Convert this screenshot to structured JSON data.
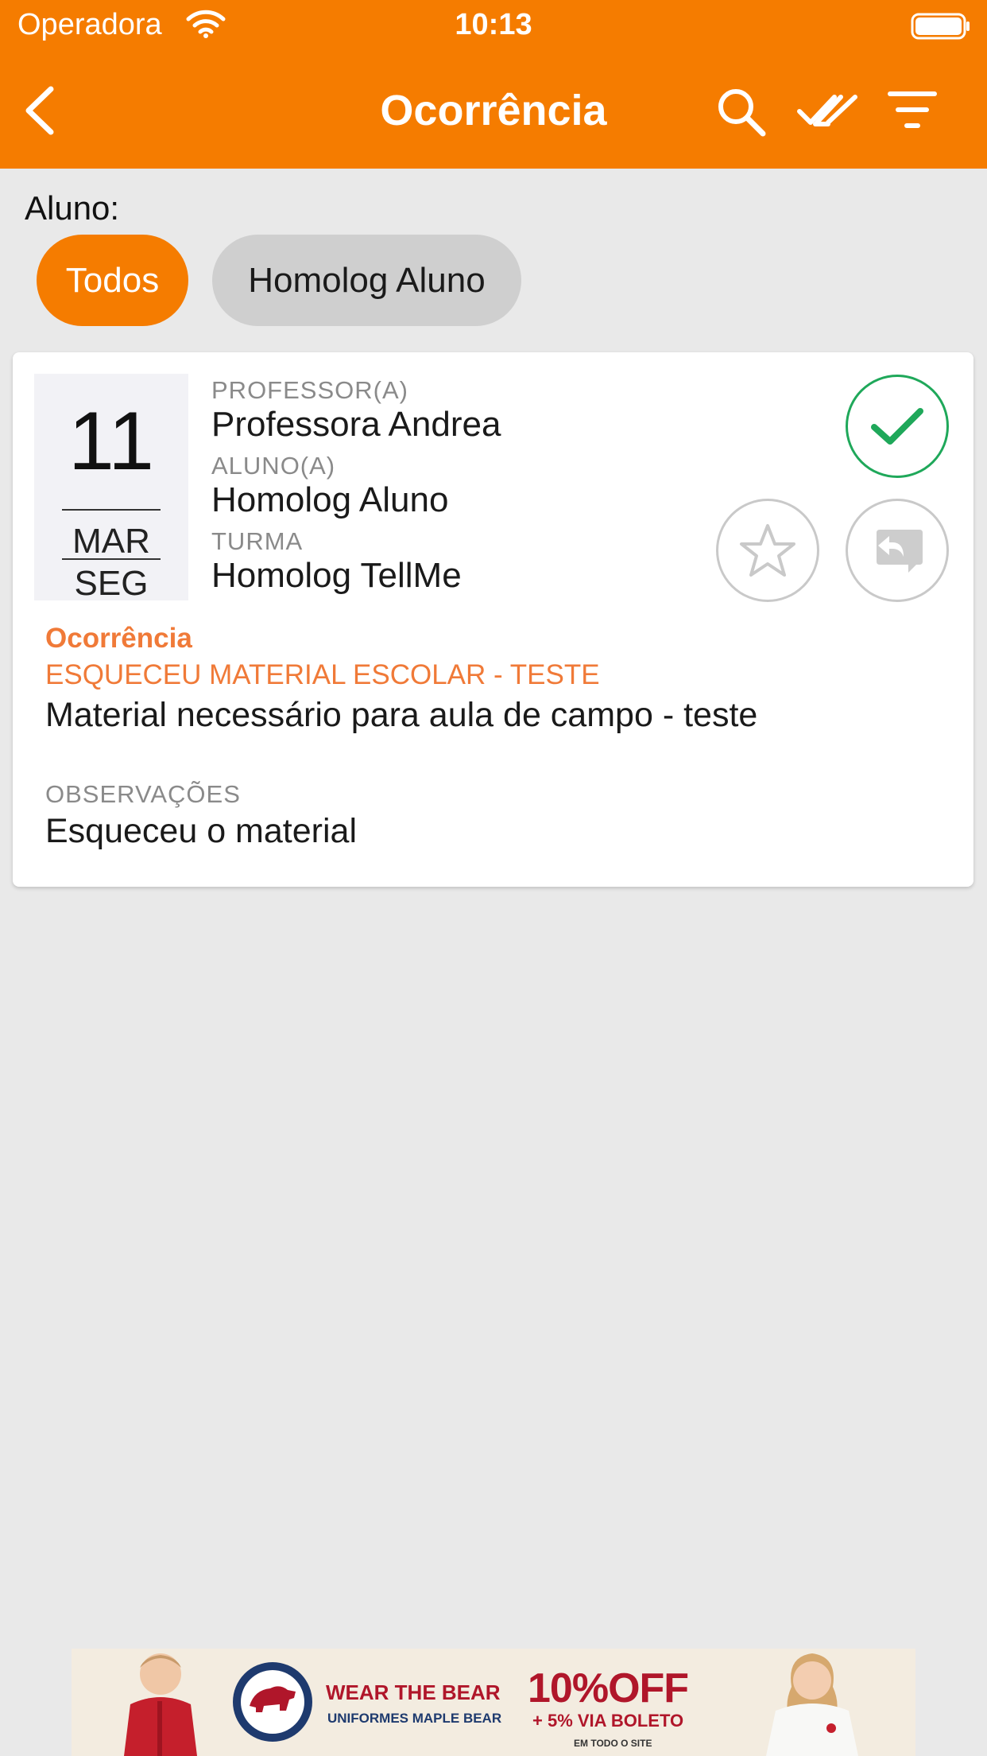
{
  "status_bar": {
    "carrier": "Operadora",
    "time": "10:13"
  },
  "nav": {
    "title": "Ocorrência"
  },
  "filter": {
    "label": "Aluno:",
    "chips": [
      {
        "label": "Todos",
        "selected": true
      },
      {
        "label": "Homolog Aluno",
        "selected": false
      }
    ]
  },
  "card": {
    "date": {
      "day": "11",
      "month": "MAR",
      "weekday": "SEG"
    },
    "teacher_label": "PROFESSOR(A)",
    "teacher": "Professora Andrea",
    "student_label": "ALUNO(A)",
    "student": "Homolog Aluno",
    "class_label": "TURMA",
    "class": "Homolog TellMe",
    "occurrence_title": "Ocorrência",
    "occurrence_type": "ESQUECEU MATERIAL ESCOLAR - TESTE",
    "occurrence_description": "Material necessário para aula de campo - teste",
    "observations_label": "OBSERVAÇÕES",
    "observations": "Esqueceu o material",
    "read": true
  },
  "ad": {
    "headline": "WEAR THE BEAR",
    "subheadline": "UNIFORMES MAPLE BEAR",
    "discount": "10%OFF",
    "extra": "+ 5% VIA BOLETO",
    "note": "EM TODO O SITE"
  },
  "colors": {
    "accent": "#f57c00",
    "check": "#1fa85a",
    "occurrence": "#f07a38"
  },
  "icons": [
    "back-icon",
    "search-icon",
    "mark-all-read-icon",
    "filter-icon",
    "check-icon",
    "star-icon",
    "reply-icon",
    "wifi-icon",
    "battery-icon"
  ]
}
